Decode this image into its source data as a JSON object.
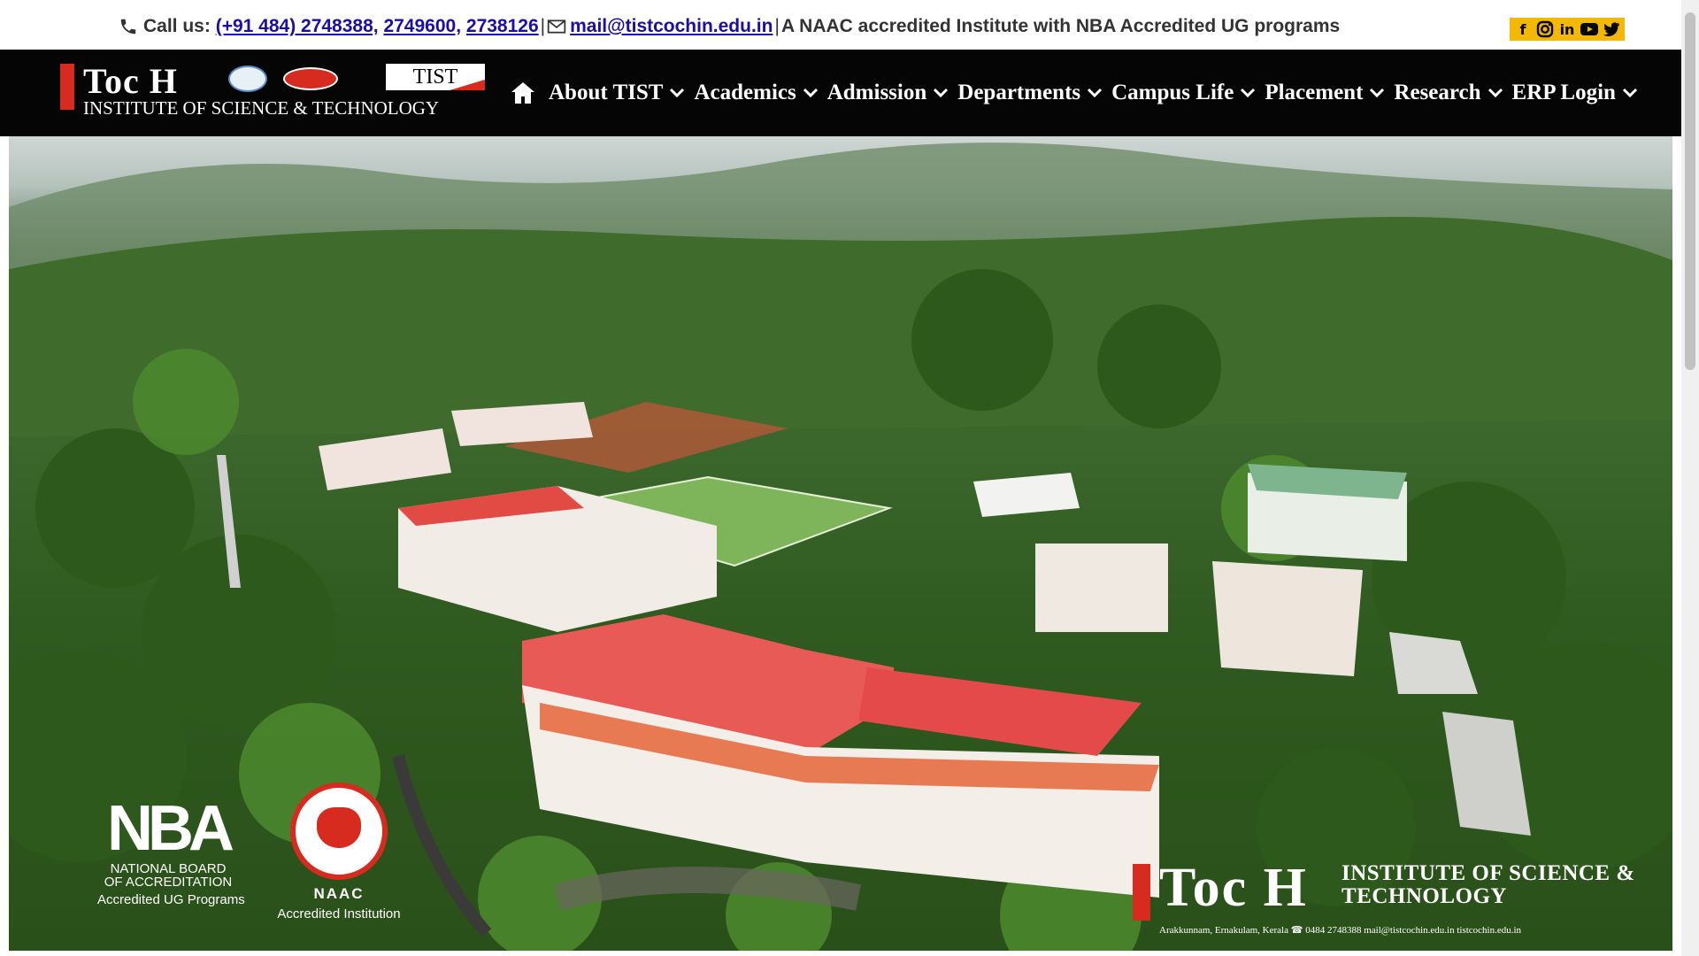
{
  "topbar": {
    "call_label": "Call us:",
    "phone_prefix": "(+91 484) 2748388,",
    "phone_2": "2749600,",
    "phone_3": "2738126",
    "separator": "|",
    "email": "mail@tistcochin.edu.in",
    "tagline": "A NAAC accredited Institute with NBA Accredited UG programs",
    "social_icons": [
      "facebook-icon",
      "instagram-icon",
      "linkedin-icon",
      "youtube-icon",
      "twitter-icon"
    ]
  },
  "logo": {
    "name": "Toc H",
    "subtitle": "INSTITUTE OF SCIENCE & TECHNOLOGY",
    "badge": "TIST"
  },
  "nav": {
    "items": [
      {
        "label": "About TIST"
      },
      {
        "label": "Academics"
      },
      {
        "label": "Admission"
      },
      {
        "label": "Departments"
      },
      {
        "label": "Campus Life"
      },
      {
        "label": "Placement"
      },
      {
        "label": "Research"
      },
      {
        "label": "ERP Login"
      }
    ]
  },
  "hero": {
    "nba": {
      "mark": "NBA",
      "line1": "NATIONAL BOARD",
      "line2": "OF ACCREDITATION",
      "caption": "Accredited UG Programs"
    },
    "naac": {
      "name": "NAAC",
      "caption": "Accredited Institution"
    },
    "watermark": {
      "name": "Toc H",
      "line1": "INSTITUTE OF SCIENCE &",
      "line2": "TECHNOLOGY",
      "footer": "Arakkunnam, Ernakulam, Kerala ☎ 0484 2748388   mail@tistcochin.edu.in  tistcochin.edu.in"
    }
  },
  "colors": {
    "nav_bg": "#050505",
    "accent_red": "#d62b1e",
    "link_blue": "#1a0dab",
    "social_bg": "#f5b800"
  }
}
